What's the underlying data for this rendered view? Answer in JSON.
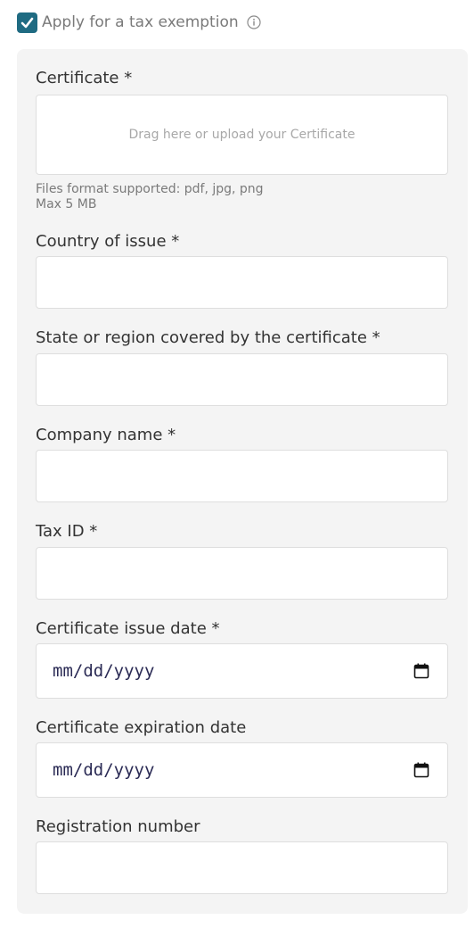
{
  "exemption": {
    "checked": true,
    "label": "Apply for a tax exemption",
    "info_icon": "info-circle-icon",
    "check_icon": "check-icon",
    "accent_color": "#1f6b82"
  },
  "form": {
    "certificate": {
      "label": "Certificate *",
      "upload_placeholder": "Drag here or upload your Certificate",
      "hint_formats": "Files format supported: pdf, jpg, png",
      "hint_size": "Max 5 MB"
    },
    "country": {
      "label": "Country of issue *",
      "value": ""
    },
    "state": {
      "label": "State or region covered by the certificate *",
      "value": ""
    },
    "company": {
      "label": "Company name *",
      "value": ""
    },
    "tax_id": {
      "label": "Tax ID *",
      "value": ""
    },
    "issue_date": {
      "label": "Certificate issue date *",
      "placeholder": "mm/dd/yyyy",
      "icon": "calendar-icon"
    },
    "expiration_date": {
      "label": "Certificate expiration date",
      "placeholder": "mm/dd/yyyy",
      "icon": "calendar-icon"
    },
    "registration": {
      "label": "Registration number",
      "value": ""
    }
  }
}
